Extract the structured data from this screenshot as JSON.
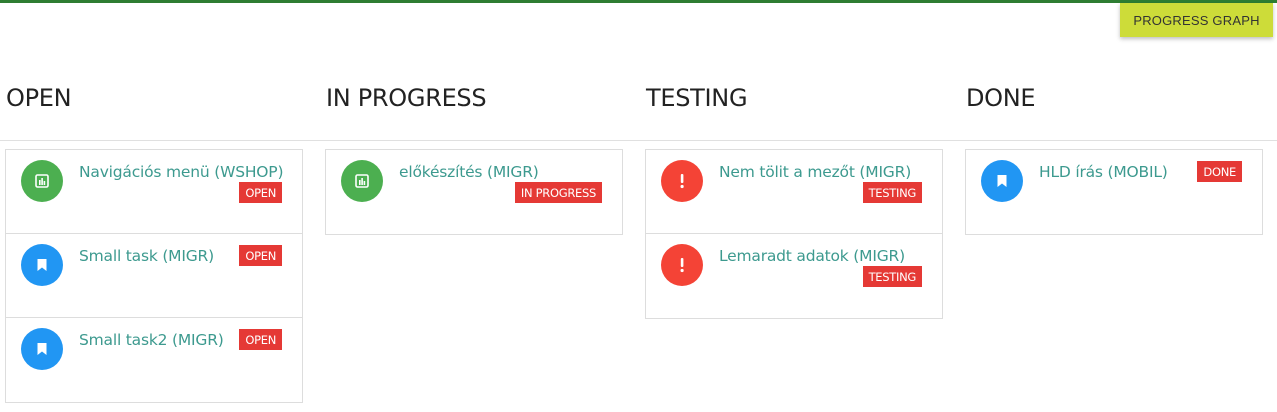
{
  "header": {
    "progress_graph_label": "PROGRESS GRAPH"
  },
  "columns": [
    {
      "title": "OPEN",
      "cards": [
        {
          "title": "Navigációs menü (WSHOP)",
          "badge": "OPEN",
          "icon": "bar-chart-icon",
          "color": "#4caf50"
        },
        {
          "title": "Small task (MIGR)",
          "badge": "OPEN",
          "icon": "bookmark-icon",
          "color": "#2196f3"
        },
        {
          "title": "Small task2 (MIGR)",
          "badge": "OPEN",
          "icon": "bookmark-icon",
          "color": "#2196f3"
        }
      ]
    },
    {
      "title": "IN PROGRESS",
      "cards": [
        {
          "title": "előkészítés (MIGR)",
          "badge": "IN PROGRESS",
          "icon": "bar-chart-icon",
          "color": "#4caf50"
        }
      ]
    },
    {
      "title": "TESTING",
      "cards": [
        {
          "title": "Nem tölit a mezőt (MIGR)",
          "badge": "TESTING",
          "icon": "exclamation-icon",
          "color": "#f44336"
        },
        {
          "title": "Lemaradt adatok (MIGR)",
          "badge": "TESTING",
          "icon": "exclamation-icon",
          "color": "#f44336"
        }
      ]
    },
    {
      "title": "DONE",
      "cards": [
        {
          "title": "HLD írás (MOBIL)",
          "badge": "DONE",
          "icon": "bookmark-icon",
          "color": "#2196f3"
        }
      ]
    }
  ],
  "colors": {
    "badge": "#e53935",
    "button": "#cddc39",
    "link": "#3d9a8f",
    "top_line": "#2e7d32"
  }
}
